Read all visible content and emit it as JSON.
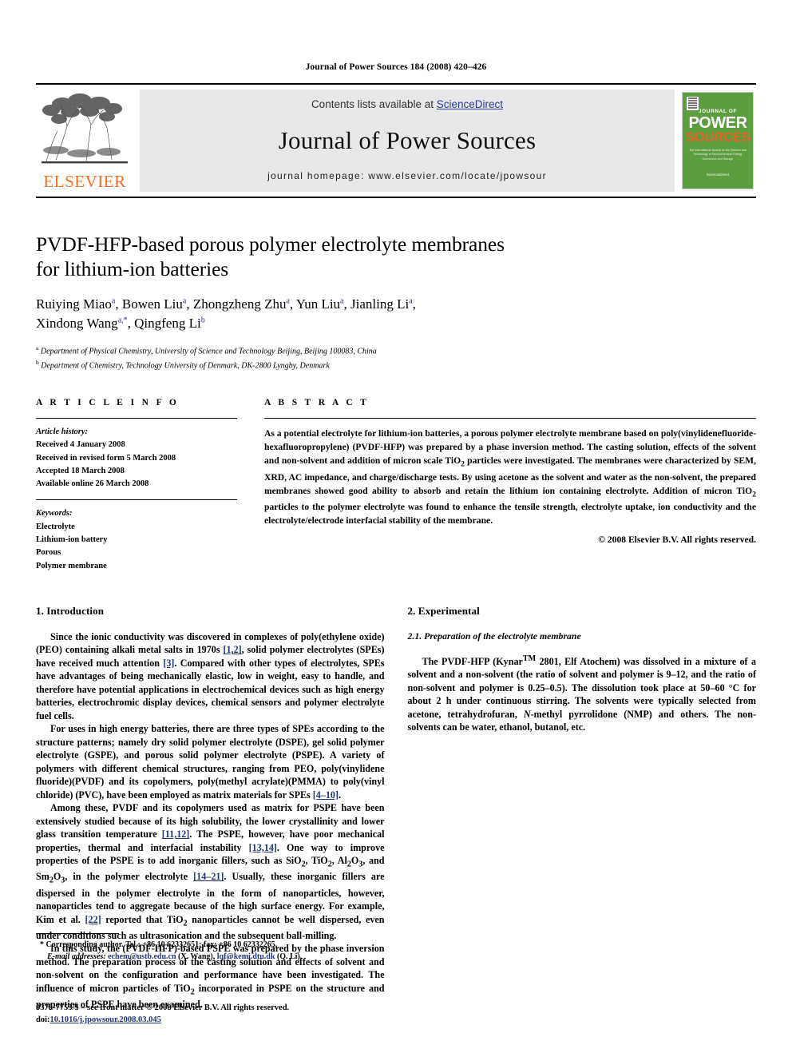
{
  "running_head": "Journal of Power Sources 184 (2008) 420–426",
  "masthead": {
    "publisher_name": "ELSEVIER",
    "contents_prefix": "Contents lists available at ",
    "sciencedirect_link": "ScienceDirect",
    "journal_title": "Journal of Power Sources",
    "homepage": "journal homepage: www.elsevier.com/locate/jpowsour",
    "cover": {
      "line1": "JOURNAL OF",
      "line2": "POWER",
      "line3": "SOURCES",
      "subtitle": "The International Journal on the Science and Technology of Electrochemical Energy Conversion and Storage",
      "sciencedirect": "ScienceDirect"
    },
    "accent_orange": "#F37021",
    "link_blue": "#2b3a9c",
    "cover_green": "#5a9e3d",
    "banner_grey": "#e8e8e8"
  },
  "article": {
    "title_line1": "PVDF-HFP-based porous polymer electrolyte membranes",
    "title_line2": "for lithium-ion batteries",
    "authors_line1_parts": [
      {
        "name": "Ruiying Miao",
        "sup": "a"
      },
      {
        "name": "Bowen Liu",
        "sup": "a"
      },
      {
        "name": "Zhongzheng Zhu",
        "sup": "a"
      },
      {
        "name": "Yun Liu",
        "sup": "a"
      },
      {
        "name": "Jianling Li",
        "sup": "a"
      }
    ],
    "authors_line2_parts": [
      {
        "name": "Xindong Wang",
        "sup": "a,*"
      },
      {
        "name": "Qingfeng Li",
        "sup": "b"
      }
    ],
    "affiliations": [
      {
        "sup": "a",
        "text": "Department of Physical Chemistry, University of Science and Technology Beijing, Beijing 100083, China"
      },
      {
        "sup": "b",
        "text": "Department of Chemistry, Technology University of Denmark, DK-2800 Lyngby, Denmark"
      }
    ]
  },
  "article_info": {
    "heading": "A R T I C L E    I N F O",
    "history_label": "Article history:",
    "history": [
      "Received 4 January 2008",
      "Received in revised form 5 March 2008",
      "Accepted 18 March 2008",
      "Available online 26 March 2008"
    ],
    "keywords_label": "Keywords:",
    "keywords": [
      "Electrolyte",
      "Lithium-ion battery",
      "Porous",
      "Polymer membrane"
    ]
  },
  "abstract": {
    "heading": "A B S T R A C T",
    "text_part1": "As a potential electrolyte for lithium-ion batteries, a porous polymer electrolyte membrane based on poly(vinylidenefluoride-hexafluoropropylene) (PVDF-HFP) was prepared by a phase inversion method. The casting solution, effects of the solvent and non-solvent and addition of micron scale TiO",
    "sub1": "2",
    "text_part2": " particles were investigated. The membranes were characterized by SEM, XRD, AC impedance, and charge/discharge tests. By using acetone as the solvent and water as the non-solvent, the prepared membranes showed good ability to absorb and retain the lithium ion containing electrolyte. Addition of micron TiO",
    "sub2": "2",
    "text_part3": " particles to the polymer electrolyte was found to enhance the tensile strength, electrolyte uptake, ion conductivity and the electrolyte/electrode interfacial stability of the membrane.",
    "copyright": "© 2008 Elsevier B.V. All rights reserved."
  },
  "sections": {
    "intro_heading": "1.  Introduction",
    "intro_p1_a": "Since the ionic conductivity was discovered in complexes of poly(ethylene oxide) (PEO) containing alkali metal salts in 1970s ",
    "intro_p1_ref1": "[1,2]",
    "intro_p1_b": ", solid polymer electrolytes (SPEs) have received much attention ",
    "intro_p1_ref2": "[3]",
    "intro_p1_c": ". Compared with other types of electrolytes, SPEs have advantages of being mechanically elastic, low in weight, easy to handle, and therefore have potential applications in electrochemical devices such as high energy batteries, electrochromic display devices, chemical sensors and polymer electrolyte fuel cells.",
    "intro_p2_a": "For uses in high energy batteries, there are three types of SPEs according to the structure patterns; namely dry solid polymer electrolyte (DSPE), gel solid polymer electrolyte (GSPE), and porous solid polymer electrolyte (PSPE). A variety of polymers with different chemical structures, ranging from PEO, poly(vinylidene fluoride)(PVDF) and its copolymers, poly(methyl acrylate)(PMMA) to poly(vinyl chloride) (PVC), have been employed as matrix materials for SPEs ",
    "intro_p2_ref": "[4–10]",
    "intro_p2_b": ".",
    "intro_p3_a": "Among these, PVDF and its copolymers used as matrix for PSPE have been extensively studied because of its high solubility, the lower crystallinity and lower glass transition temperature ",
    "intro_p3_ref": "[11,12]",
    "intro_p3_b": ". The PSPE, however, have poor mechanical properties, thermal and interfacial instability ",
    "intro_p3_ref2": "[13,14]",
    "intro_p3_c": ". One way to improve properties of the PSPE is to add inorganic fillers, such as SiO",
    "intro_p3_c2": ", TiO",
    "intro_p3_c3": ", Al",
    "intro_p3_c4": "O",
    "intro_p3_c5": ", and Sm",
    "intro_p3_c6": "O",
    "intro_p3_d": ", in the polymer electrolyte ",
    "intro_p3_ref3": "[14–21]",
    "intro_p3_e": ". Usually, these inorganic fillers are dispersed in the polymer electrolyte in the form of nanoparticles, however, nanoparticles tend to aggregate because of the high surface energy. For example, Kim et al. ",
    "intro_p3_ref4": "[22]",
    "intro_p3_f": " reported that TiO",
    "intro_p3_g": " nanoparticles cannot be well dispersed, even under conditions such as ultrasonication and the subsequent ball-milling.",
    "intro_p4_a": "In this study, the (PVDF-HFP)-based PSPE was prepared by the phase inversion method. The preparation process of the casting solution and effects of solvent and non-solvent on the configuration and performance have been investigated. The influence of micron particles of TiO",
    "intro_p4_b": " incorporated in PSPE on the structure and properties of PSPE have been examined.",
    "exp_heading": "2.  Experimental",
    "exp_sub_heading": "2.1.  Preparation of the electrolyte membrane",
    "exp_p1_a": "The PVDF-HFP (Kynar",
    "exp_p1_tm": "TM",
    "exp_p1_b": " 2801, Elf Atochem) was dissolved in a mixture of a solvent and a non-solvent (the ratio of solvent and polymer is 9–12, and the ratio of non-solvent and polymer is 0.25–0.5). The dissolution took place at 50–60 °C for about 2 h under continuous stirring. The solvents were typically selected from acetone, tetrahydrofuran, ",
    "exp_p1_italic": "N",
    "exp_p1_c": "-methyl pyrrolidone (NMP) and others. The non-solvents can be water, ethanol, butanol, etc.",
    "sub2": "2",
    "sub3": "3"
  },
  "footnote": {
    "marker": "*",
    "corresponding": "Corresponding author. Tel.: +86 10 62332651; fax: +86 10 62332265.",
    "email_label": "E-mail addresses:",
    "email1": "echem@ustb.edu.cn",
    "email1_who": " (X. Wang),",
    "email2": "lqf@kemi.dtu.dk",
    "email2_who": " (Q. Li)."
  },
  "footer": {
    "issn_line": "0378-7753/$ – see front matter © 2008 Elsevier B.V. All rights reserved.",
    "doi_label": "doi:",
    "doi_value": "10.1016/j.jpowsour.2008.03.045"
  }
}
